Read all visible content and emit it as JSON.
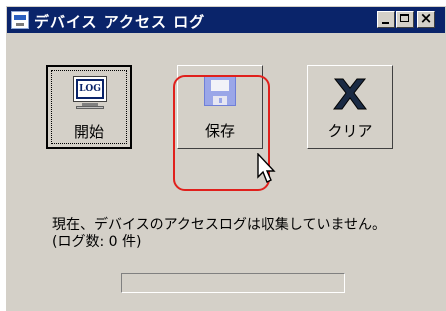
{
  "window": {
    "title": "デバイス アクセス ログ",
    "title_icon": "log-icon",
    "minimize_glyph": "_",
    "maximize_glyph": "□",
    "close_glyph": "×"
  },
  "toolbar": {
    "start": {
      "label": "開始",
      "icon": "monitor-icon",
      "icon_text": "LOG"
    },
    "save": {
      "label": "保存",
      "icon": "floppy-disk-icon"
    },
    "clear": {
      "label": "クリア",
      "icon": "x-icon"
    }
  },
  "status": {
    "line1": "現在、デバイスのアクセスログは収集していません。",
    "line2": "(ログ数: 0 件)"
  },
  "progress": {
    "value": 0
  },
  "colors": {
    "titlebar": "#0a246a",
    "face": "#d4d0c8",
    "highlight": "#e0201c"
  }
}
